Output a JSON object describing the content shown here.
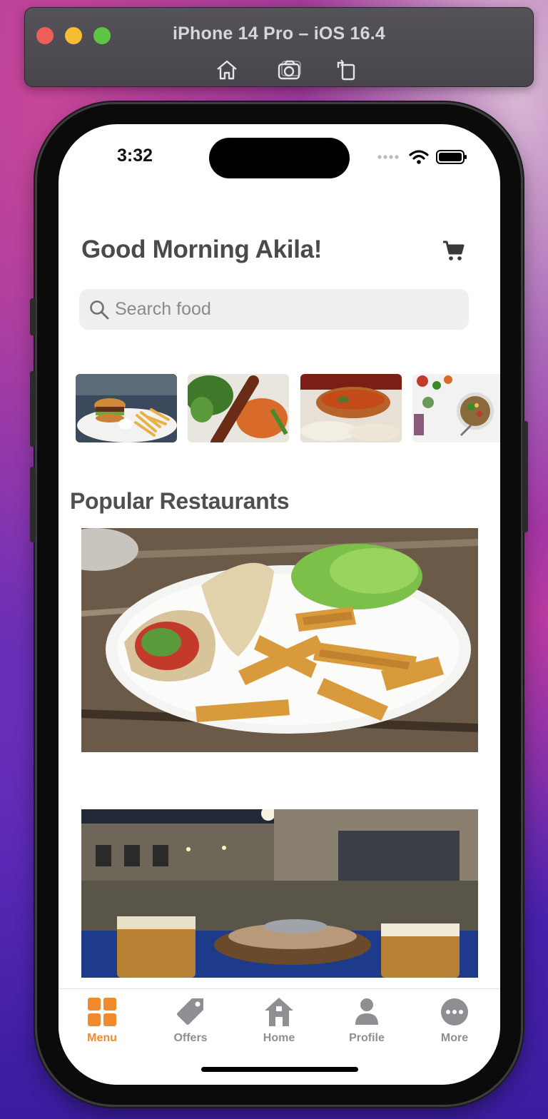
{
  "simulator": {
    "title": "iPhone 14 Pro – iOS 16.4",
    "tools": [
      "home-icon",
      "screenshot-icon",
      "rotate-icon"
    ]
  },
  "status_bar": {
    "time": "3:32"
  },
  "header": {
    "greeting": "Good Morning Akila!"
  },
  "search": {
    "placeholder": "Search food",
    "value": ""
  },
  "categories": [
    {
      "icon": "burger-fries-photo"
    },
    {
      "icon": "kebab-plate-photo"
    },
    {
      "icon": "curry-bowl-photo"
    },
    {
      "icon": "salad-bowl-photo"
    }
  ],
  "popular": {
    "title": "Popular Restaurants",
    "items": [
      {
        "icon": "wrap-and-wedges-photo"
      },
      {
        "icon": "night-street-cafe-photo"
      }
    ]
  },
  "tabbar": {
    "items": [
      {
        "label": "Menu",
        "icon": "grid-icon",
        "active": true
      },
      {
        "label": "Offers",
        "icon": "tag-icon",
        "active": false
      },
      {
        "label": "Home",
        "icon": "home-icon",
        "active": false
      },
      {
        "label": "Profile",
        "icon": "person-icon",
        "active": false
      },
      {
        "label": "More",
        "icon": "more-icon",
        "active": false
      }
    ]
  },
  "colors": {
    "accent": "#f08a2c",
    "inactive": "#8e8e93",
    "title": "#4a4a4c"
  }
}
